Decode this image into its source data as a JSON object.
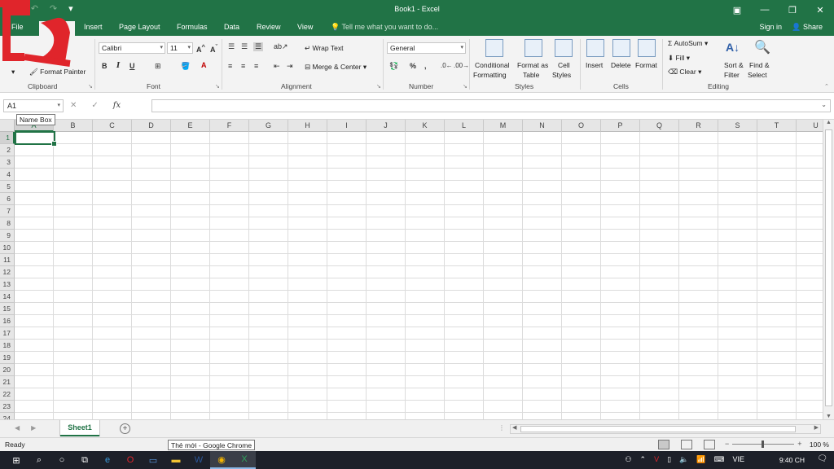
{
  "window": {
    "title": "Book1 - Excel"
  },
  "ribbon_tabs": [
    {
      "label": "File"
    },
    {
      "label": "Home"
    },
    {
      "label": "Insert"
    },
    {
      "label": "Page Layout"
    },
    {
      "label": "Formulas"
    },
    {
      "label": "Data"
    },
    {
      "label": "Review"
    },
    {
      "label": "View"
    }
  ],
  "tell_me": "Tell me what you want to do...",
  "account": {
    "sign_in": "Sign in",
    "share": "Share"
  },
  "clipboard": {
    "format_painter": "Format Painter",
    "group": "Clipboard"
  },
  "font": {
    "name": "Calibri",
    "size": "11",
    "bold": "B",
    "italic": "I",
    "underline": "U",
    "group": "Font"
  },
  "alignment": {
    "wrap": "Wrap Text",
    "merge": "Merge & Center",
    "group": "Alignment"
  },
  "number": {
    "format": "General",
    "percent": "%",
    "comma": ",",
    "group": "Number"
  },
  "styles": {
    "conditional": "Conditional",
    "formatting": "Formatting",
    "format_as": "Format as",
    "table": "Table",
    "cell": "Cell",
    "cell_styles": "Styles",
    "group": "Styles"
  },
  "cells_grp": {
    "insert": "Insert",
    "delete": "Delete",
    "format": "Format",
    "group": "Cells"
  },
  "editing": {
    "autosum": "AutoSum",
    "fill": "Fill",
    "clear": "Clear",
    "sort": "Sort &",
    "filter": "Filter",
    "find": "Find &",
    "select": "Select",
    "group": "Editing"
  },
  "formula_bar": {
    "name_box": "A1",
    "fx": "fx",
    "tooltip": "Name Box"
  },
  "columns": [
    "A",
    "B",
    "C",
    "D",
    "E",
    "F",
    "G",
    "H",
    "I",
    "J",
    "K",
    "L",
    "M",
    "N",
    "O",
    "P",
    "Q",
    "R",
    "S",
    "T",
    "U"
  ],
  "rows": [
    "1",
    "2",
    "3",
    "4",
    "5",
    "6",
    "7",
    "8",
    "9",
    "10",
    "11",
    "12",
    "13",
    "14",
    "15",
    "16",
    "17",
    "18",
    "19",
    "20",
    "21",
    "22",
    "23",
    "24"
  ],
  "sheets": [
    {
      "label": "Sheet1"
    }
  ],
  "status": {
    "ready": "Ready",
    "chrome_tip": "Thẻ mới - Google Chrome",
    "zoom": "100 %"
  },
  "taskbar": {
    "lang": "VIE",
    "time": "9:40 CH"
  },
  "colors": {
    "excel_green": "#217346",
    "red_overlay": "#e0252b"
  }
}
